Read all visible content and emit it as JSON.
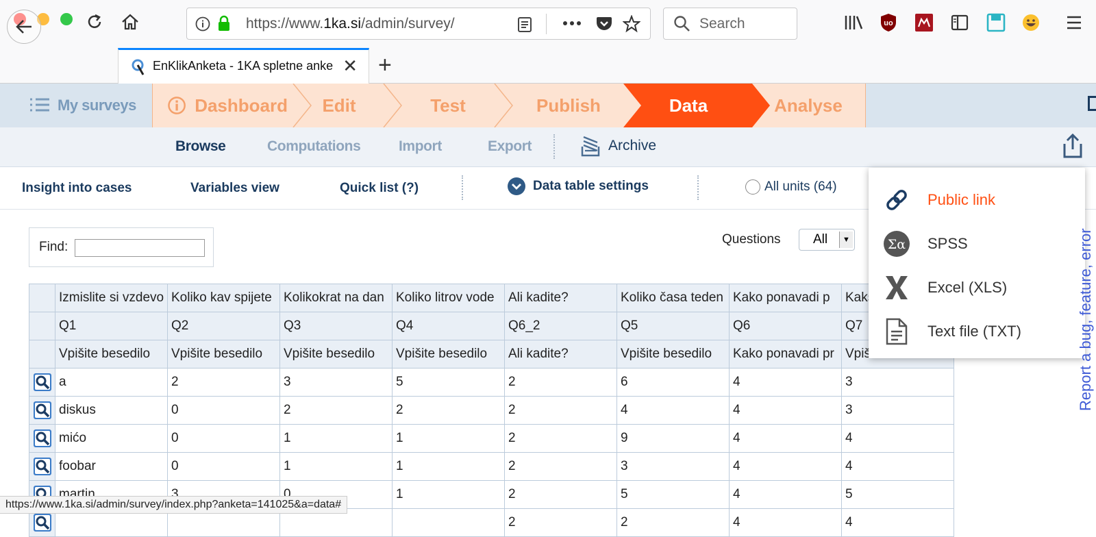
{
  "browser": {
    "url_display": "https://www.",
    "url_domain": "1ka.si",
    "url_path": "/admin/survey/",
    "search_placeholder": "Search",
    "tab_title": "EnKlikAnketa - 1KA spletne anke",
    "status_url": "https://www.1ka.si/admin/survey/index.php?anketa=141025&a=data#"
  },
  "app_nav": {
    "my_surveys": "My surveys",
    "steps": [
      {
        "label": "Dashboard",
        "active": false
      },
      {
        "label": "Edit",
        "active": false
      },
      {
        "label": "Test",
        "active": false
      },
      {
        "label": "Publish",
        "active": false
      },
      {
        "label": "Data",
        "active": true
      },
      {
        "label": "Analyse",
        "active": false
      }
    ],
    "accent_color": "#ff4f12"
  },
  "sub_nav": {
    "browse": "Browse",
    "computations": "Computations",
    "import": "Import",
    "export": "Export",
    "archive": "Archive"
  },
  "third_nav": {
    "insight": "Insight into cases",
    "variables": "Variables view",
    "quicklist": "Quick list (?)",
    "settings": "Data table settings",
    "all_units": "All units (64)"
  },
  "filters": {
    "find_label": "Find:",
    "questions_label": "Questions",
    "questions_value": "All"
  },
  "table": {
    "header_titles": [
      "Izmislite si vzdevo",
      "Koliko kav spijete",
      "Kolikokrat na dan",
      "Koliko litrov vode",
      "Ali kadite?",
      "Koliko časa teden",
      "Kako ponavadi p",
      "Kaks"
    ],
    "header_codes": [
      "Q1",
      "Q2",
      "Q3",
      "Q4",
      "Q6_2",
      "Q5",
      "Q6",
      "Q7"
    ],
    "header_types": [
      "Vpišite besedilo",
      "Vpišite besedilo",
      "Vpišite besedilo",
      "Vpišite besedilo",
      "Ali kadite?",
      "Vpišite besedilo",
      "Kako ponavadi pr",
      "Vpiši"
    ],
    "rows": [
      [
        "a",
        "2",
        "3",
        "5",
        "2",
        "6",
        "4",
        "3"
      ],
      [
        "diskus",
        "0",
        "2",
        "2",
        "2",
        "4",
        "4",
        "3"
      ],
      [
        "mićo",
        "0",
        "1",
        "1",
        "2",
        "9",
        "4",
        "4"
      ],
      [
        "foobar",
        "0",
        "1",
        "1",
        "2",
        "3",
        "4",
        "4"
      ],
      [
        "martin",
        "3",
        "0",
        "1",
        "2",
        "5",
        "4",
        "5"
      ],
      [
        "",
        "",
        "",
        "",
        "2",
        "2",
        "4",
        "4"
      ]
    ]
  },
  "export_menu": {
    "items": [
      {
        "label": "Public link",
        "icon": "link-icon",
        "highlighted": true
      },
      {
        "label": "SPSS",
        "icon": "spss-icon",
        "highlighted": false
      },
      {
        "label": "Excel (XLS)",
        "icon": "excel-icon",
        "highlighted": false
      },
      {
        "label": "Text file (TXT)",
        "icon": "text-file-icon",
        "highlighted": false
      }
    ]
  },
  "feedback": {
    "report_bug": "Report a bug, feature, error"
  }
}
